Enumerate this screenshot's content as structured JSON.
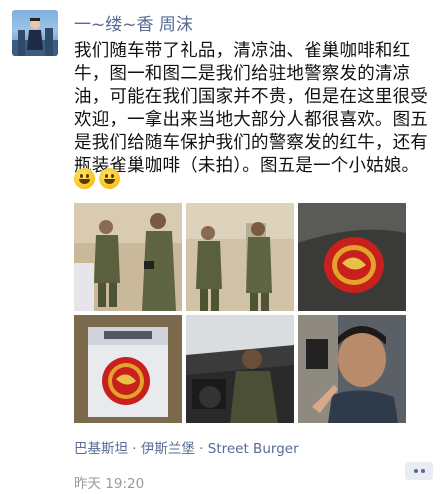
{
  "post": {
    "author": "一~缕~香 周沫",
    "text": "我们随车带了礼品，清凉油、雀巢咖啡和红牛，图一和图二是我们给驻地警察发的清凉油，可能在我们国家并不贵，但是在这里很受欢迎，一拿出来当地大部分人都很喜欢。图五是我们给随车保护我们的警察发的红牛，还有瓶装雀巢咖啡（未拍）。图五是一个小姑娘。",
    "emojis": [
      "grin-emoji",
      "grin-emoji"
    ],
    "photos": [
      {
        "name": "photo-1-police-officers"
      },
      {
        "name": "photo-2-police-officers"
      },
      {
        "name": "photo-3-balm-tin"
      },
      {
        "name": "photo-4-balm-packet"
      },
      {
        "name": "photo-5-car-interior"
      },
      {
        "name": "photo-6-selfie"
      }
    ],
    "location": "巴基斯坦 · 伊斯兰堡 · Street Burger",
    "time": "昨天 19:20"
  },
  "colors": {
    "link": "#566b94",
    "text": "#111111",
    "meta": "#9a9a9a",
    "olive_uniform": "#5a5f3e",
    "balm_red": "#c8201c"
  }
}
